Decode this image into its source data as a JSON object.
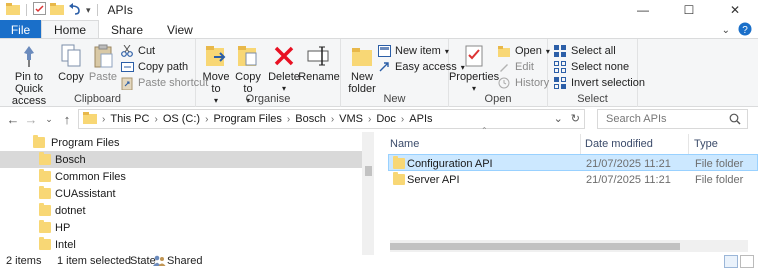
{
  "window": {
    "title": "APIs",
    "controls": [
      "minimize",
      "maximize",
      "close"
    ]
  },
  "tabs": [
    "File",
    "Home",
    "Share",
    "View"
  ],
  "ribbon": {
    "clipboard": {
      "label": "Clipboard",
      "pin": "Pin to Quick access",
      "copy": "Copy",
      "paste": "Paste",
      "cut": "Cut",
      "copy_path": "Copy path",
      "paste_shortcut": "Paste shortcut"
    },
    "organise": {
      "label": "Organise",
      "move_to": "Move to",
      "copy_to": "Copy to",
      "delete": "Delete",
      "rename": "Rename"
    },
    "new": {
      "label": "New",
      "new_folder": "New folder",
      "new_item": "New item",
      "easy_access": "Easy access"
    },
    "open": {
      "label": "Open",
      "properties": "Properties",
      "open": "Open",
      "edit": "Edit",
      "history": "History"
    },
    "select": {
      "label": "Select",
      "select_all": "Select all",
      "select_none": "Select none",
      "invert_selection": "Invert selection"
    }
  },
  "address": {
    "path": [
      "This PC",
      "OS (C:)",
      "Program Files",
      "Bosch",
      "VMS",
      "Doc",
      "APIs"
    ],
    "search_placeholder": "Search APIs"
  },
  "nav_pane": {
    "items": [
      {
        "label": "Program Files",
        "indent": 0,
        "selected": false
      },
      {
        "label": "Bosch",
        "indent": 1,
        "selected": true
      },
      {
        "label": "Common Files",
        "indent": 1,
        "selected": false
      },
      {
        "label": "CUAssistant",
        "indent": 1,
        "selected": false
      },
      {
        "label": "dotnet",
        "indent": 1,
        "selected": false
      },
      {
        "label": "HP",
        "indent": 1,
        "selected": false
      },
      {
        "label": "Intel",
        "indent": 1,
        "selected": false
      }
    ]
  },
  "file_list": {
    "columns": [
      "Name",
      "Date modified",
      "Type"
    ],
    "rows": [
      {
        "name": "Configuration API",
        "date": "21/07/2025 11:21",
        "type": "File folder",
        "selected": true
      },
      {
        "name": "Server API",
        "date": "21/07/2025 11:21",
        "type": "File folder",
        "selected": false
      }
    ]
  },
  "status": {
    "count": "2 items",
    "selection": "1 item selected",
    "state_label": "State:",
    "state_value": "Shared"
  },
  "colors": {
    "file_tab": "#1a6fc9",
    "selection": "#cce8ff",
    "folder": "#f8d775",
    "delete": "#e81123"
  }
}
